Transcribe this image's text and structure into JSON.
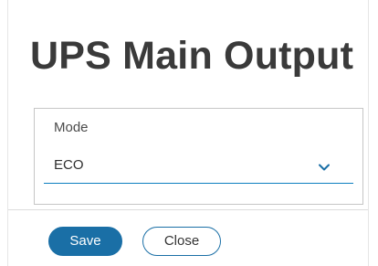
{
  "dialog": {
    "title": "UPS Main Output"
  },
  "mode_field": {
    "label": "Mode",
    "value": "ECO",
    "dropdown_icon": "chevron-down-icon"
  },
  "actions": {
    "save_label": "Save",
    "close_label": "Close"
  },
  "colors": {
    "accent": "#1a6fa6",
    "title_text": "#3a3a3a"
  }
}
